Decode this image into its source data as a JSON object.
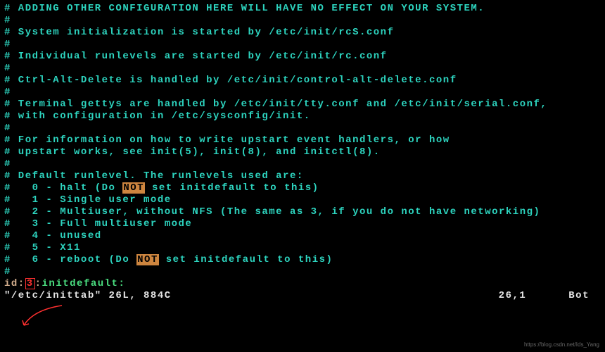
{
  "lines": [
    "# ADDING OTHER CONFIGURATION HERE WILL HAVE NO EFFECT ON YOUR SYSTEM.",
    "#",
    "# System initialization is started by /etc/init/rcS.conf",
    "#",
    "# Individual runlevels are started by /etc/init/rc.conf",
    "#",
    "# Ctrl-Alt-Delete is handled by /etc/init/control-alt-delete.conf",
    "#",
    "# Terminal gettys are handled by /etc/init/tty.conf and /etc/init/serial.conf,",
    "# with configuration in /etc/sysconfig/init.",
    "#",
    "# For information on how to write upstart event handlers, or how",
    "# upstart works, see init(5), init(8), and initctl(8).",
    "#",
    "# Default runlevel. The runlevels used are:"
  ],
  "runlevels": {
    "l0_a": "#   0 - halt (Do ",
    "l0_not": "NOT",
    "l0_b": " set initdefault to this)",
    "l1": "#   1 - Single user mode",
    "l2": "#   2 - Multiuser, without NFS (The same as 3, if you do not have networking)",
    "l3": "#   3 - Full multiuser mode",
    "l4": "#   4 - unused",
    "l5": "#   5 - X11",
    "l6_a": "#   6 - reboot (Do ",
    "l6_not": "NOT",
    "l6_b": " set initdefault to this)"
  },
  "hash_only": "#",
  "last": {
    "id": "id:",
    "level": "3",
    "sep": ":",
    "initdefault": "initdefault:"
  },
  "status": {
    "file": "\"/etc/inittab\" 26L, 884C",
    "pos": "26,1",
    "loc": "Bot"
  },
  "watermark": "https://blog.csdn.net/Ids_Yang"
}
